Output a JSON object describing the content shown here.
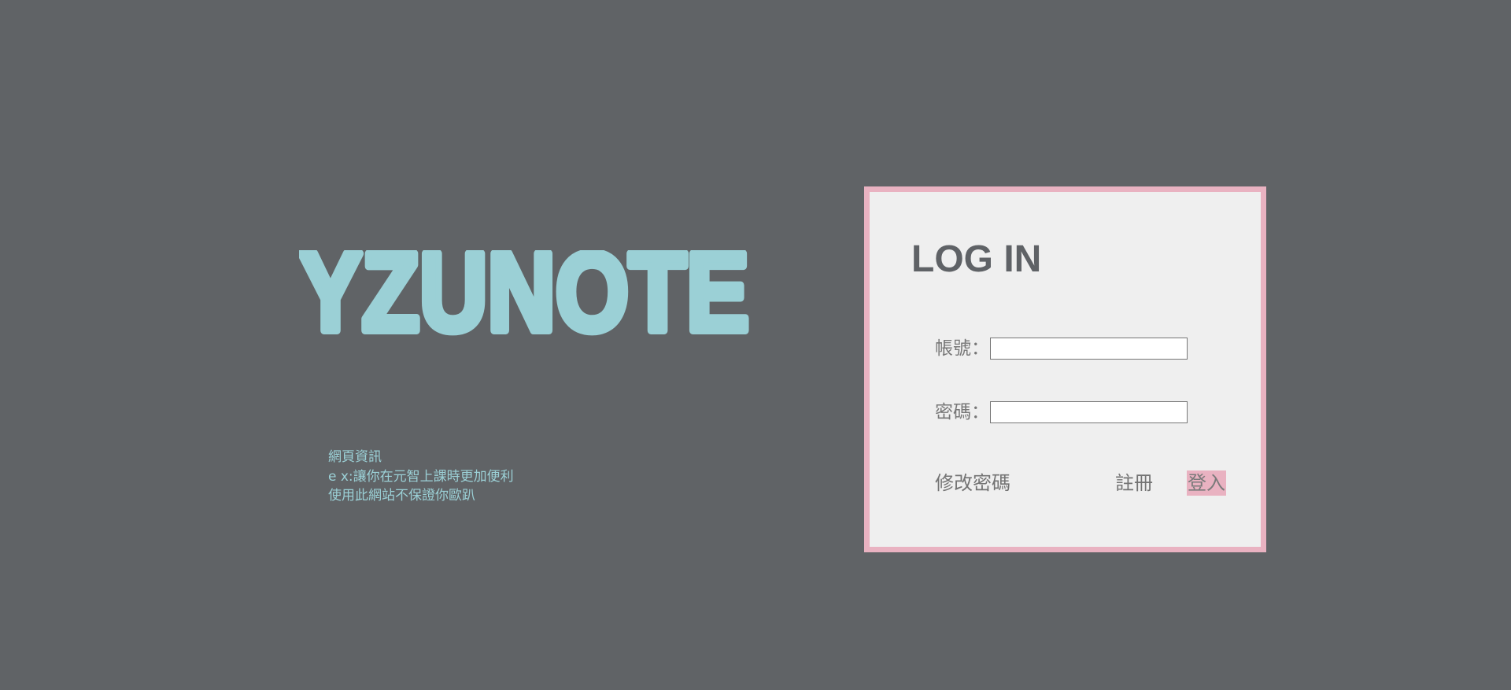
{
  "brand": {
    "logo_text": "YZUNOTE",
    "logo_color": "#9bd0d6"
  },
  "info": {
    "lines": [
      "網頁資訊",
      "e x:讓你在元智上課時更加便利",
      "使用此網站不保證你歐趴"
    ]
  },
  "login": {
    "title": "LOG IN",
    "account_label": "帳號：",
    "account_value": "",
    "password_label": "密碼：",
    "password_value": "",
    "change_password_label": "修改密碼",
    "register_label": "註冊",
    "submit_label": "登入"
  },
  "colors": {
    "page_background": "#606366",
    "panel_background": "#efefef",
    "panel_border": "#e9b2c1",
    "accent_pink": "#e9b2c1",
    "accent_teal": "#9bd0d6"
  }
}
